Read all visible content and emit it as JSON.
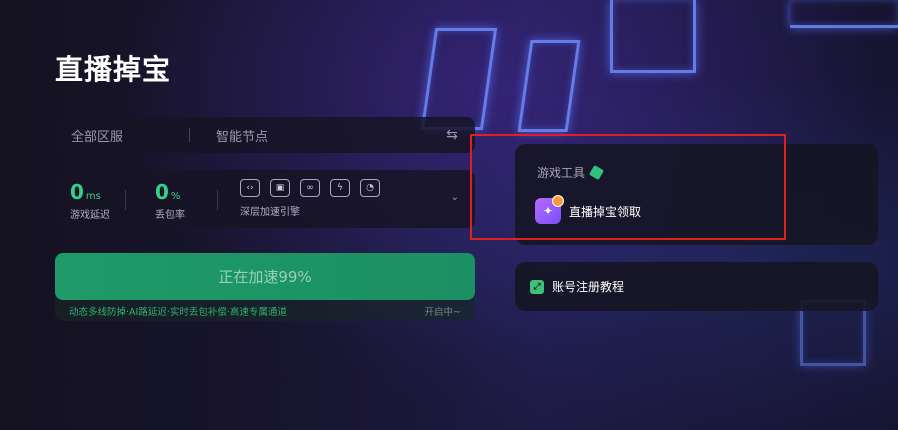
{
  "page": {
    "title": "直播掉宝"
  },
  "region_bar": {
    "region": "全部区服",
    "node": "智能节点"
  },
  "stats": {
    "latency": {
      "value": "0",
      "unit": "ms",
      "label": "游戏延迟"
    },
    "loss": {
      "value": "0",
      "unit": "%",
      "label": "丢包率"
    },
    "engine_label": "深层加速引擎"
  },
  "accelerate": {
    "button_label": "正在加速99%",
    "footer_text": "动态多线防掉·AI路延迟·实时丢包补偿·高速专属通道",
    "status": "开启中~"
  },
  "tools": {
    "title": "游戏工具",
    "item_label": "直播掉宝领取"
  },
  "tutorial": {
    "label": "账号注册教程"
  },
  "colors": {
    "accent_green": "#1f9a68",
    "highlight_red": "#e02020"
  }
}
